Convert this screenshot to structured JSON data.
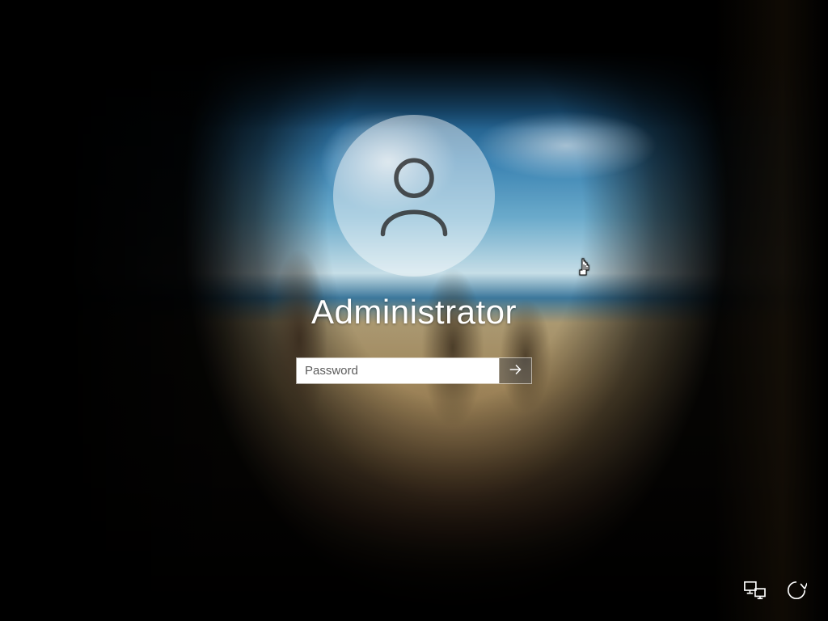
{
  "login": {
    "username": "Administrator",
    "password_placeholder": "Password",
    "password_value": ""
  },
  "icons": {
    "avatar": "user-icon",
    "submit": "arrow-right-icon",
    "network": "network-icon",
    "power_ease": "ease-of-access-icon"
  }
}
